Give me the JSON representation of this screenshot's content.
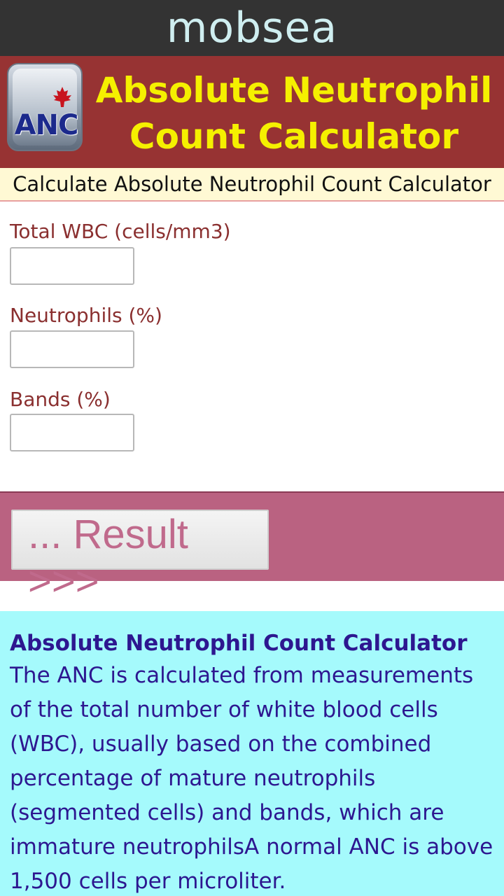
{
  "topbar": {
    "brand": "mobsea"
  },
  "header": {
    "icon_label": "ANC",
    "title_line1": "Absolute Neutrophil",
    "title_line2": "Count Calculator"
  },
  "subheader": {
    "text": "Calculate Absolute Neutrophil Count Calculator"
  },
  "form": {
    "fields": [
      {
        "label": "Total WBC (cells/mm3)",
        "value": ""
      },
      {
        "label": "Neutrophils (%)",
        "value": ""
      },
      {
        "label": "Bands (%)",
        "value": ""
      }
    ]
  },
  "result": {
    "button_label": "... Result >>>"
  },
  "info": {
    "title": "Absolute Neutrophil Count Calculator",
    "body": "The ANC is calculated from measurements of the total number of white blood cells (WBC), usually based on the combined percentage of mature neutrophils (segmented cells) and bands, which are immature neutrophilsA normal ANC is above 1,500 cells per microliter."
  },
  "colors": {
    "topbar": "#333333",
    "header": "#973333",
    "title": "#f5f000",
    "result_band": "#ba6281",
    "info_bg": "#a5fafc",
    "info_text": "#2d1790"
  }
}
